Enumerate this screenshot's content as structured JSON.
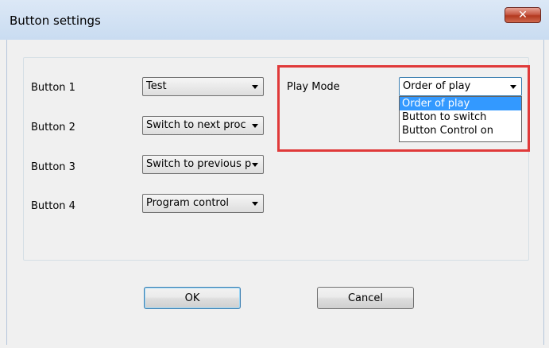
{
  "window": {
    "title": "Button settings",
    "close_glyph": "✕"
  },
  "buttons": [
    {
      "label": "Button 1",
      "value": "Test"
    },
    {
      "label": "Button 2",
      "value": "Switch to next proc"
    },
    {
      "label": "Button 3",
      "value": "Switch to previous p"
    },
    {
      "label": "Button 4",
      "value": "Program control"
    }
  ],
  "play_mode": {
    "label": "Play Mode",
    "value": "Order of play",
    "options": [
      "Order of play",
      "Button to switch",
      "Button Control on"
    ],
    "selected_index": 0
  },
  "actions": {
    "ok_label": "OK",
    "cancel_label": "Cancel"
  },
  "colors": {
    "highlight": "#e03a3a",
    "selection": "#3399ff"
  }
}
